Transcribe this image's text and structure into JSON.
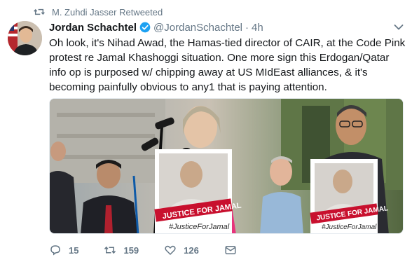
{
  "retweet": {
    "label": "M. Zuhdi Jasser Retweeted"
  },
  "author": {
    "display_name": "Jordan Schachtel",
    "handle": "@JordanSchachtel",
    "separator": "·",
    "time": "4h"
  },
  "tweet": {
    "text": "Oh look, it's Nihad Awad, the Hamas-tied director of CAIR, at the Code Pink protest re Jamal Khashoggi situation. One more sign this Erdogan/Qatar info op is purposed w/ chipping away at US MIdEast alliances, & it's becoming painfully obvious to any1 that is paying attention."
  },
  "media": {
    "sign_left": {
      "line1": "JUSTICE FOR JAMAL",
      "line2": "#JusticeForJamal"
    },
    "sign_right": {
      "line1": "JUSTICE FOR JAMAL",
      "line2": "#JusticeForJamal"
    }
  },
  "actions": {
    "replies": "15",
    "retweets": "159",
    "likes": "126"
  },
  "colors": {
    "accent": "#1da1f2",
    "muted": "#657786",
    "text": "#14171a",
    "sign_red": "#c8102e"
  }
}
